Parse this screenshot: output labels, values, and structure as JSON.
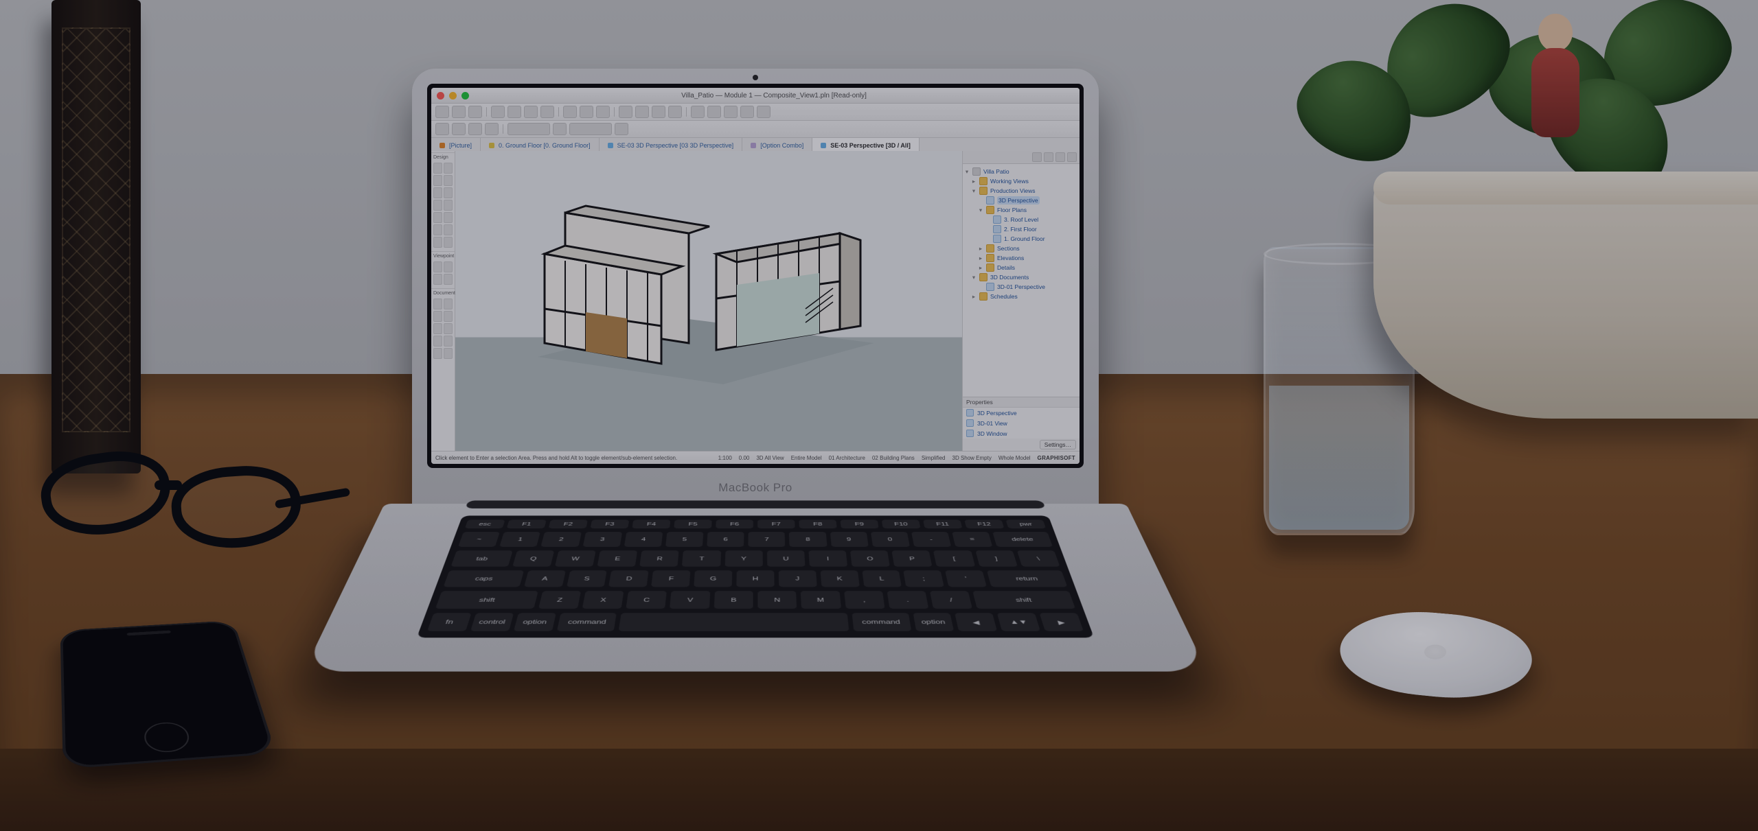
{
  "laptop_branding": "MacBook Pro",
  "app": {
    "window_title": "Villa_Patio — Module 1 — Composite_View1.pln [Read-only]",
    "tabs": [
      {
        "label": "[Picture]",
        "color": "#e58a2b"
      },
      {
        "label": "0. Ground Floor [0. Ground Floor]",
        "color": "#e5c84a"
      },
      {
        "label": "SE-03 3D Perspective [03 3D Perspective]",
        "color": "#6fb6ea"
      },
      {
        "label": "[Option Combo]",
        "color": "#bda9d8"
      },
      {
        "label": "SE-03 Perspective [3D / All]",
        "color": "#6fb6ea",
        "active": true
      }
    ],
    "navigator": {
      "root": "Villa Patio",
      "items": [
        {
          "d": 1,
          "icon": "folder",
          "label": "Working Views",
          "tw": "▸"
        },
        {
          "d": 1,
          "icon": "folder",
          "label": "Production Views",
          "tw": "▾"
        },
        {
          "d": 2,
          "icon": "view",
          "label": "3D Perspective",
          "sel": true
        },
        {
          "d": 2,
          "icon": "folder",
          "label": "Floor Plans",
          "tw": "▾"
        },
        {
          "d": 3,
          "icon": "view",
          "label": "3. Roof Level"
        },
        {
          "d": 3,
          "icon": "view",
          "label": "2. First Floor"
        },
        {
          "d": 3,
          "icon": "view",
          "label": "1. Ground Floor"
        },
        {
          "d": 2,
          "icon": "folder",
          "label": "Sections",
          "tw": "▸"
        },
        {
          "d": 2,
          "icon": "folder",
          "label": "Elevations",
          "tw": "▸"
        },
        {
          "d": 2,
          "icon": "folder",
          "label": "Details",
          "tw": "▸"
        },
        {
          "d": 1,
          "icon": "folder",
          "label": "3D Documents",
          "tw": "▾"
        },
        {
          "d": 2,
          "icon": "view",
          "label": "3D-01 Perspective"
        },
        {
          "d": 1,
          "icon": "folder",
          "label": "Schedules",
          "tw": "▸"
        }
      ]
    },
    "properties": {
      "title": "Properties",
      "rows": [
        {
          "label": "3D Perspective"
        },
        {
          "label": "3D-01 View"
        },
        {
          "label": "3D Window"
        }
      ],
      "settings_btn": "Settings…"
    },
    "toolbox_sections": [
      "Design",
      "Viewpoint",
      "Document"
    ],
    "status": {
      "hint": "Click element to Enter a selection Area. Press and hold Alt to toggle element/sub-element selection.",
      "zoom": "1:100",
      "segs": [
        "0.00",
        "3D All View",
        "Entire Model",
        "01 Architecture",
        "02 Building Plans",
        "Simplified",
        "3D Show Empty",
        "Whole Model"
      ],
      "brand": "GRAPHISOFT"
    }
  },
  "keyboard_rows": {
    "fn": [
      "esc",
      "F1",
      "F2",
      "F3",
      "F4",
      "F5",
      "F6",
      "F7",
      "F8",
      "F9",
      "F10",
      "F11",
      "F12",
      "pwr"
    ],
    "num": [
      "~",
      "1",
      "2",
      "3",
      "4",
      "5",
      "6",
      "7",
      "8",
      "9",
      "0",
      "-",
      "=",
      "delete"
    ],
    "qw": [
      "tab",
      "Q",
      "W",
      "E",
      "R",
      "T",
      "Y",
      "U",
      "I",
      "O",
      "P",
      "[",
      "]",
      "\\"
    ],
    "as": [
      "caps",
      "A",
      "S",
      "D",
      "F",
      "G",
      "H",
      "J",
      "K",
      "L",
      ";",
      "'",
      "return"
    ],
    "zx": [
      "shift",
      "Z",
      "X",
      "C",
      "V",
      "B",
      "N",
      "M",
      ",",
      ".",
      "/",
      "shift"
    ],
    "mod": [
      "fn",
      "control",
      "option",
      "command",
      "",
      "command",
      "option",
      "◀",
      "▲▼",
      "▶"
    ]
  }
}
